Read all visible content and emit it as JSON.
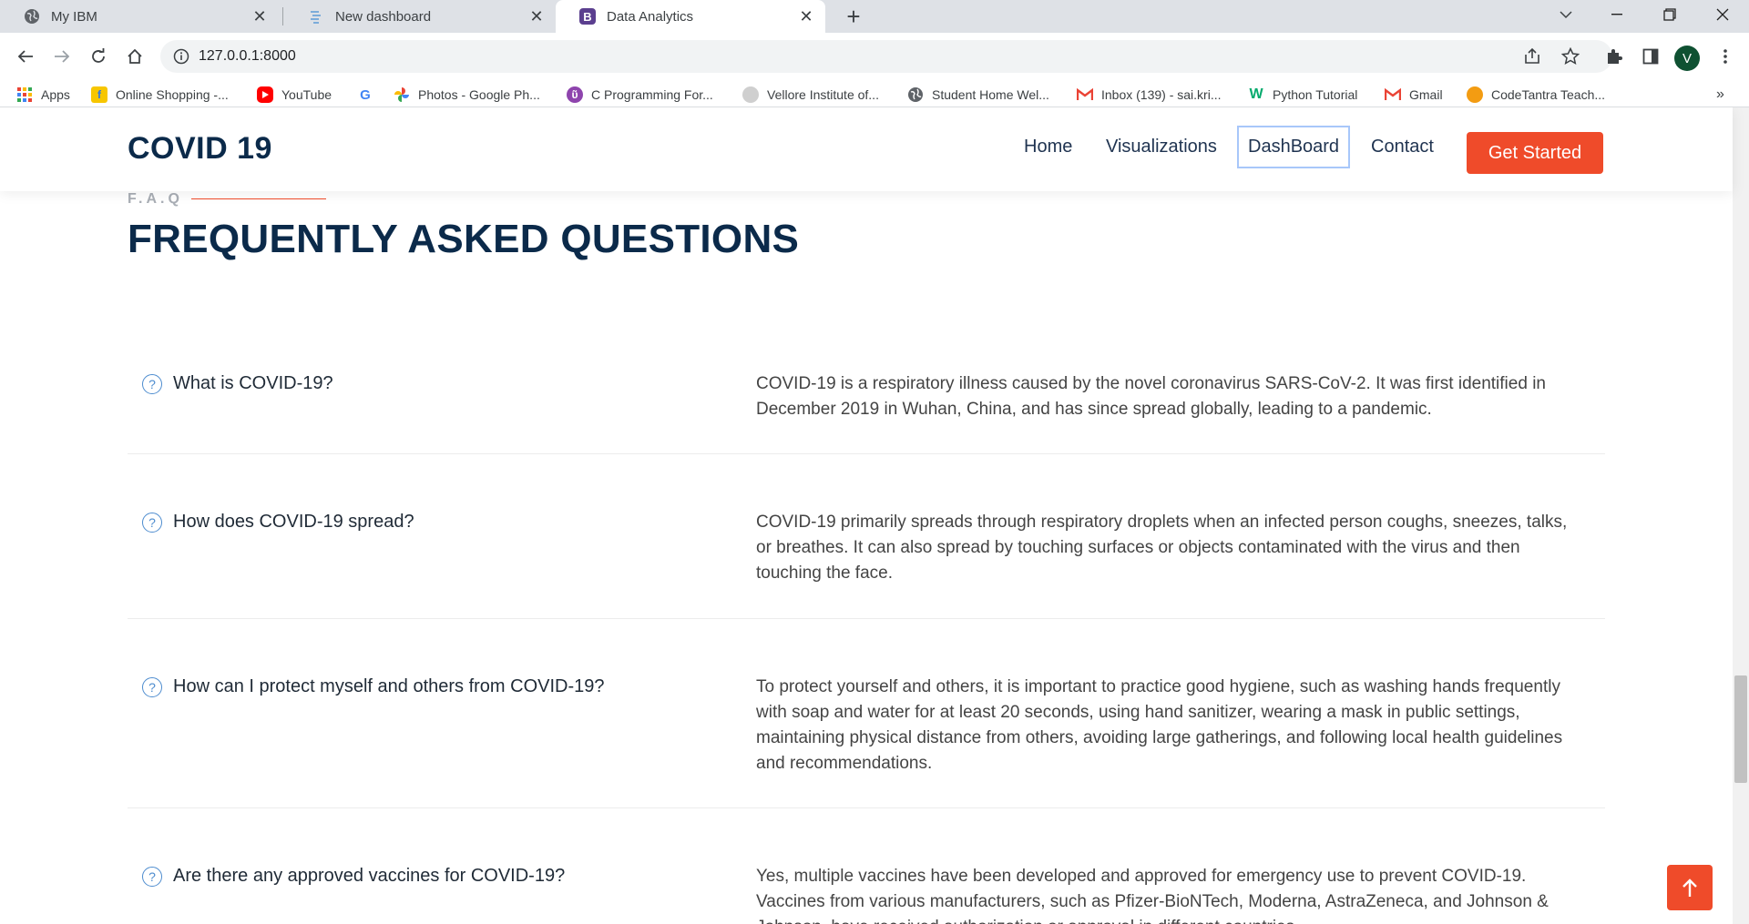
{
  "tabs": [
    {
      "title": "My IBM",
      "icon": "globe-icon",
      "active": false
    },
    {
      "title": "New dashboard",
      "icon": "dashboard-icon",
      "active": false
    },
    {
      "title": "Data Analytics",
      "icon": "bootstrap-icon",
      "active": true
    }
  ],
  "address_bar": {
    "url": "127.0.0.1:8000"
  },
  "profile": {
    "initial": "V",
    "color": "#0f5132"
  },
  "bookmarks": [
    {
      "label": "Apps",
      "icon": "apps-grid-icon"
    },
    {
      "label": "Online Shopping -...",
      "icon": "flipkart-icon"
    },
    {
      "label": "YouTube",
      "icon": "youtube-icon"
    },
    {
      "label": "",
      "icon": "google-icon"
    },
    {
      "label": "Photos - Google Ph...",
      "icon": "google-photos-icon"
    },
    {
      "label": "C Programming For...",
      "icon": "c-programming-icon"
    },
    {
      "label": "Vellore Institute of...",
      "icon": "vit-icon"
    },
    {
      "label": "Student Home Wel...",
      "icon": "globe-icon"
    },
    {
      "label": "Inbox (139) - sai.kri...",
      "icon": "gmail-icon"
    },
    {
      "label": "Python Tutorial",
      "icon": "w3schools-icon"
    },
    {
      "label": "Gmail",
      "icon": "gmail-icon"
    },
    {
      "label": "CodeTantra Teach...",
      "icon": "codetantra-icon"
    }
  ],
  "site": {
    "logo": "COVID 19",
    "nav": [
      "Home",
      "Visualizations",
      "DashBoard",
      "Contact"
    ],
    "cta": "Get Started",
    "accent_color": "#ef4b2a",
    "navy_color": "#0b2a4a"
  },
  "faq": {
    "label": "F.A.Q",
    "title": "FREQUENTLY ASKED QUESTIONS",
    "items": [
      {
        "question": "What is COVID-19?",
        "answer": "COVID-19 is a respiratory illness caused by the novel coronavirus SARS-CoV-2. It was first identified in December 2019 in Wuhan, China, and has since spread globally, leading to a pandemic."
      },
      {
        "question": "How does COVID-19 spread?",
        "answer": "COVID-19 primarily spreads through respiratory droplets when an infected person coughs, sneezes, talks, or breathes. It can also spread by touching surfaces or objects contaminated with the virus and then touching the face."
      },
      {
        "question": "How can I protect myself and others from COVID-19?",
        "answer": "To protect yourself and others, it is important to practice good hygiene, such as washing hands frequently with soap and water for at least 20 seconds, using hand sanitizer, wearing a mask in public settings, maintaining physical distance from others, avoiding large gatherings, and following local health guidelines and recommendations."
      },
      {
        "question": "Are there any approved vaccines for COVID-19?",
        "answer": "Yes, multiple vaccines have been developed and approved for emergency use to prevent COVID-19. Vaccines from various manufacturers, such as Pfizer-BioNTech, Moderna, AstraZeneca, and Johnson & Johnson, have received authorization or approval in different countries."
      }
    ]
  }
}
